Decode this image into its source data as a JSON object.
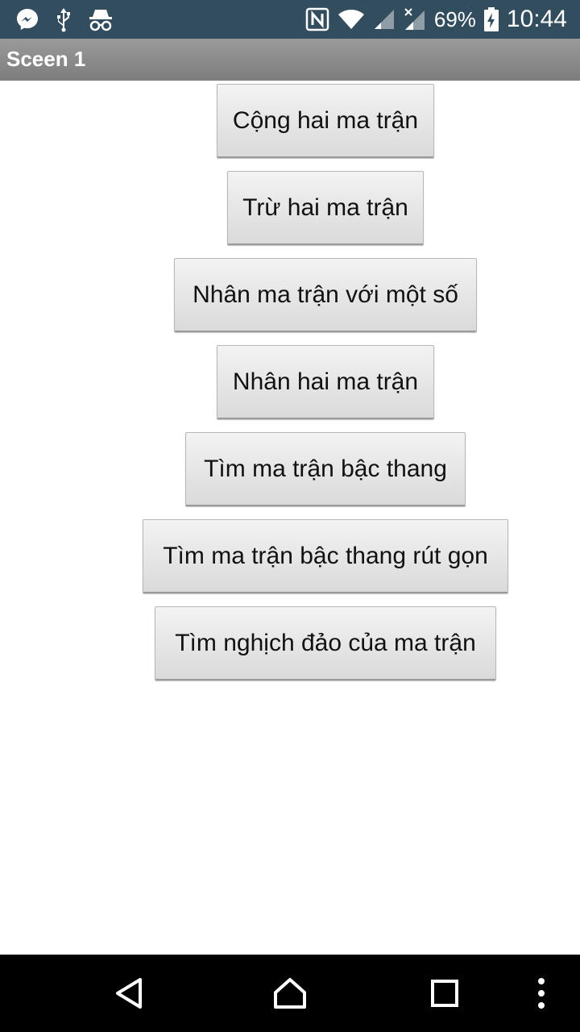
{
  "status_bar": {
    "icons_left": [
      "messenger-icon",
      "usb-icon",
      "incognito-icon"
    ],
    "icons_right": [
      "nfc-icon",
      "wifi-icon",
      "signal-icon",
      "signal-no-data-icon",
      "battery-charging-icon"
    ],
    "battery_percent": "69%",
    "time": "10:44",
    "background_color": "#324d5e"
  },
  "title_bar": {
    "title": "Sceen 1"
  },
  "buttons": [
    {
      "label": "Cộng hai ma trận"
    },
    {
      "label": "Trừ hai ma trận"
    },
    {
      "label": "Nhân ma trận với một số"
    },
    {
      "label": "Nhân hai ma trận"
    },
    {
      "label": "Tìm ma trận bậc thang"
    },
    {
      "label": "Tìm ma trận bậc thang rút gọn"
    },
    {
      "label": "Tìm nghịch đảo của ma trận"
    }
  ],
  "nav_bar": {
    "icons": [
      "back-icon",
      "home-icon",
      "recents-icon",
      "menu-icon"
    ]
  }
}
